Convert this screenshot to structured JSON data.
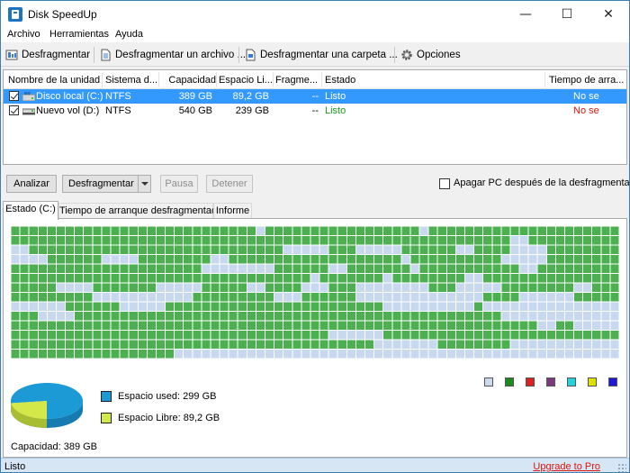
{
  "window": {
    "title": "Disk SpeedUp",
    "min_glyph": "—",
    "max_glyph": "☐",
    "close_glyph": "✕"
  },
  "menu": [
    "Archivo",
    "Herramientas",
    "Ayuda"
  ],
  "toolbar": {
    "defrag": "Desfragmentar",
    "defrag_file": "Desfragmentar un archivo ...",
    "defrag_folder": "Desfragmentar una carpeta ...",
    "options": "Opciones"
  },
  "drive_list": {
    "headers": [
      "Nombre de la unidad",
      "Sistema d...",
      "Capacidad",
      "Espacio Li...",
      "Fragme...",
      "Estado",
      "Tiempo de arra..."
    ],
    "rows": [
      {
        "name": "Disco local (C:)",
        "fs": "NTFS",
        "capacity": "389 GB",
        "free": "89,2 GB",
        "frag": "--",
        "status": "Listo",
        "boot_time": "No se",
        "checked": true,
        "selected": true
      },
      {
        "name": "Nuevo vol (D:)",
        "fs": "NTFS",
        "capacity": "540 GB",
        "free": "239 GB",
        "frag": "--",
        "status": "Listo",
        "boot_time": "No se",
        "checked": true,
        "selected": false
      }
    ]
  },
  "controls": {
    "analyze": "Analizar",
    "defrag": "Desfragmentar",
    "pause": "Pausa",
    "stop": "Detener",
    "shutdown_label": "Apagar PC después de la desfragmentación",
    "shutdown_checked": false
  },
  "tabs": [
    "Estado (C:)",
    "Tiempo de arranque desfragmentado",
    "Informe"
  ],
  "map": {
    "cols": 67,
    "rows": 14,
    "colors": {
      "used": "#4caf50",
      "free": "#c8d8ee"
    },
    "free_fraction": 0.229
  },
  "legend_colors": [
    "#c8d8ee",
    "#1e8a1e",
    "#e02020",
    "#7a3a7a",
    "#22d4e0",
    "#e0e000",
    "#1a1ad8"
  ],
  "disk_usage": {
    "used_label": "Espacio used: 299 GB",
    "free_label": "Espacio Libre: 89,2 GB",
    "used_color": "#1b9ad6",
    "free_color": "#d4e84a",
    "used_gb": 299,
    "free_gb": 89.2,
    "capacity_label": "Capacidad: 389 GB"
  },
  "status": {
    "text": "Listo",
    "upgrade": "Upgrade to Pro"
  }
}
